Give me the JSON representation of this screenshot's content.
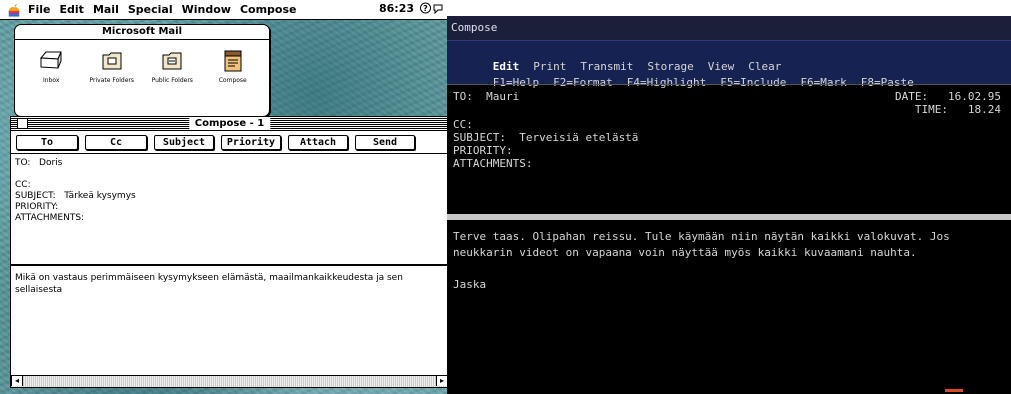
{
  "mac": {
    "menubar": {
      "items": [
        "File",
        "Edit",
        "Mail",
        "Special",
        "Window",
        "Compose"
      ],
      "clock": "86:23"
    },
    "mail_window": {
      "title": "Microsoft Mail",
      "icons": [
        {
          "label": "Inbox",
          "icon": "inbox-tray-icon"
        },
        {
          "label": "Private Folders",
          "icon": "folder-icon"
        },
        {
          "label": "Public Folders",
          "icon": "folder-icon"
        },
        {
          "label": "Compose",
          "icon": "compose-pad-icon"
        }
      ]
    },
    "compose": {
      "title": "Compose - 1",
      "buttons": [
        "To",
        "Cc",
        "Subject",
        "Priority",
        "Attach",
        "Send"
      ],
      "to": "TO:   Doris",
      "cc": "CC:",
      "subject": "SUBJECT:   Tärkeä kysymys",
      "priority": "PRIORITY:",
      "attachments": "ATTACHMENTS:",
      "body": "Mikä on vastaus perimmäiseen kysymykseen elämästä, maailmankaikkeudesta ja sen sellaisesta"
    }
  },
  "terminal": {
    "title": "Compose",
    "menu": [
      "Edit",
      "Print",
      "Transmit",
      "Storage",
      "View",
      "Clear"
    ],
    "function_keys": [
      "F1=Help",
      "F2=Format",
      "F4=Highlight",
      "F5=Include",
      "F6=Mark",
      "F8=Paste"
    ],
    "to": "TO:  Mauri",
    "date": "DATE:   16.02.95",
    "time": "TIME:   18.24",
    "cc": "CC:",
    "subject": "SUBJECT:  Terveisiä etelästä",
    "priority": "PRIORITY:",
    "attachments": "ATTACHMENTS:",
    "body": "Terve taas. Olipahan reissu. Tule käymään niin näytän kaikki valokuvat. Jos neukkarin videot on vapaana voin näyttää myös kaikki kuvaamani nauhta.\n\nJaska"
  }
}
